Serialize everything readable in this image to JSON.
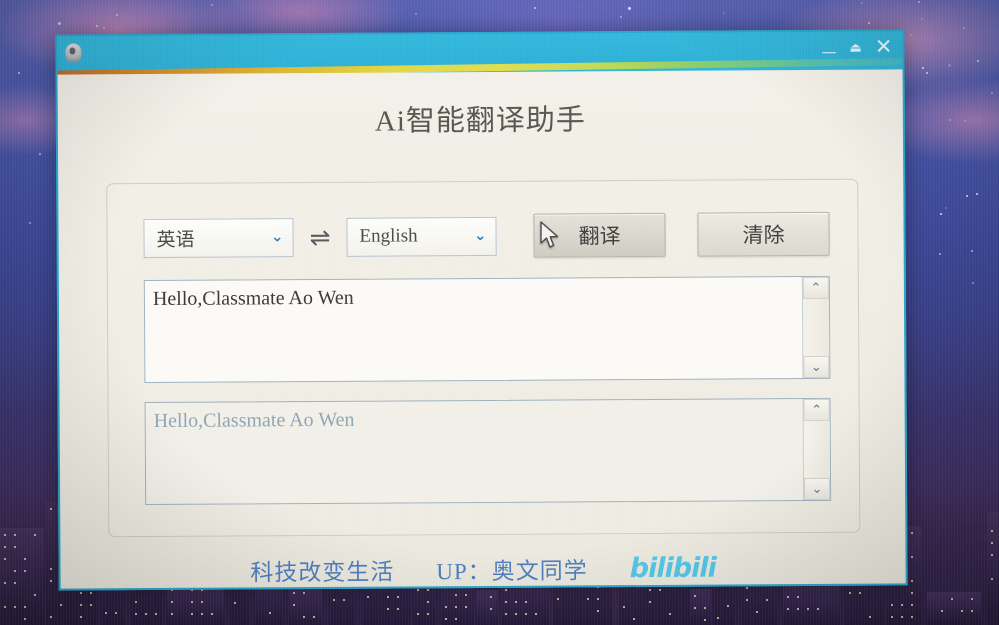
{
  "window": {
    "app_icon": "app-capsule-icon",
    "controls": {
      "minimize": "—",
      "maximize": "⏏",
      "close": "✕"
    }
  },
  "page_title": "Ai智能翻译助手",
  "controls": {
    "source_language": "英语",
    "target_language": "English",
    "swap_icon": "⇌",
    "chevron_icon": "⌄",
    "translate_label": "翻译",
    "clear_label": "清除"
  },
  "source_area": {
    "text": "Hello,Classmate Ao Wen",
    "scroll_up_icon": "⌃",
    "scroll_down_icon": "⌄"
  },
  "target_area": {
    "text": "Hello,Classmate Ao Wen",
    "scroll_up_icon": "⌃",
    "scroll_down_icon": "⌄"
  },
  "footer": {
    "slogan": "科技改变生活",
    "uploader": "UP：奥文同学",
    "brand": "bilibili"
  },
  "colors": {
    "window_border": "#2aa9cf",
    "titlebar": "#31b4d8",
    "client_bg": "#efece3",
    "accent_blue": "#4f7fc0",
    "brand_blue": "#56c7e8",
    "chevron_blue": "#2f7ebc",
    "target_text": "#8fa6b5"
  }
}
